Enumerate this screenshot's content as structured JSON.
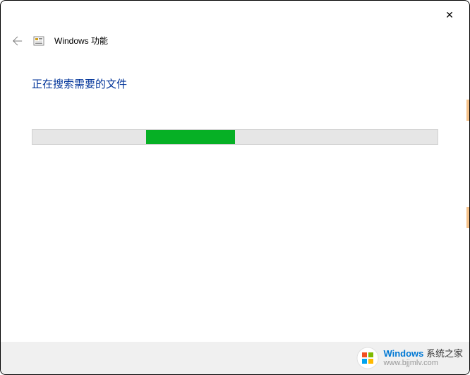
{
  "window": {
    "title": "Windows 功能",
    "close_label": "✕"
  },
  "content": {
    "status_text": "正在搜索需要的文件",
    "progress_percent": 22
  },
  "watermark": {
    "brand": "Windows",
    "tag": " 系统之家",
    "url": "www.bjjmlv.com"
  },
  "icons": {
    "back_arrow": "back-arrow-icon",
    "app_icon": "windows-features-icon",
    "close": "close-icon",
    "wm_logo": "windows-logo-icon"
  }
}
